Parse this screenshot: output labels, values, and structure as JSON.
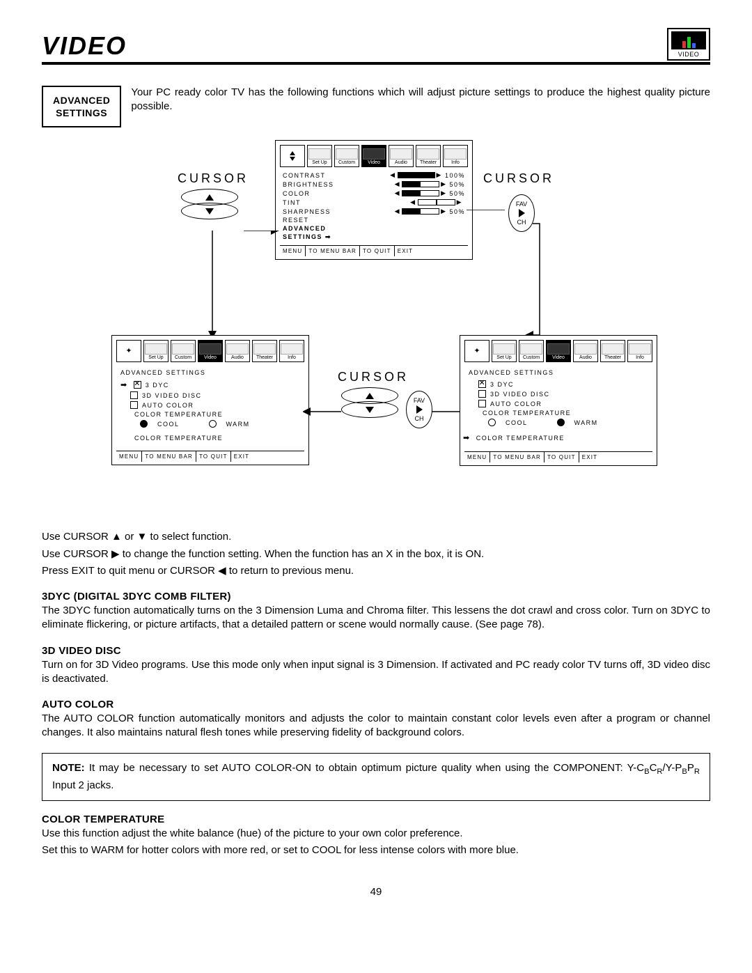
{
  "header": {
    "title": "VIDEO",
    "logo_label": "VIDEO"
  },
  "intro": {
    "box_line1": "ADVANCED",
    "box_line2": "SETTINGS",
    "text": "Your PC ready color TV has the following functions which will adjust picture settings to produce the highest quality picture possible."
  },
  "labels": {
    "cursor": "CURSOR",
    "fav": "FAV",
    "ch": "CH"
  },
  "osd_tabs": [
    "Set Up",
    "Custom",
    "Video",
    "Audio",
    "Theater",
    "Info"
  ],
  "osd_footer": {
    "menu": "MENU",
    "bar": "TO MENU BAR",
    "quit": "TO QUIT",
    "exit": "EXIT"
  },
  "video_menu": {
    "rows": [
      {
        "label": "CONTRAST",
        "value": "100%",
        "fill": 100
      },
      {
        "label": "BRIGHTNESS",
        "value": "50%",
        "fill": 50
      },
      {
        "label": "COLOR",
        "value": "50%",
        "fill": 50
      },
      {
        "label": "TINT",
        "value": "",
        "fill": 50,
        "center": true
      },
      {
        "label": "SHARPNESS",
        "value": "50%",
        "fill": 50
      },
      {
        "label": "RESET",
        "value": "",
        "plain": true
      }
    ],
    "advanced": "ADVANCED",
    "settings": "SETTINGS"
  },
  "adv_menu": {
    "header": "ADVANCED SETTINGS",
    "items": [
      {
        "label": "3 DYC",
        "checked": true
      },
      {
        "label": "3D VIDEO DISC",
        "checked": false
      },
      {
        "label": "AUTO COLOR",
        "checked": false
      }
    ],
    "colortemp_label": "COLOR TEMPERATURE",
    "cool": "COOL",
    "warm": "WARM",
    "bottom": "COLOR TEMPERATURE"
  },
  "instructions": {
    "l1": "Use CURSOR ▲ or ▼ to select function.",
    "l2": "Use CURSOR ▶ to change the function setting. When the function has an  X  in the box, it is ON.",
    "l3": "Press EXIT to quit menu or CURSOR ◀ to return to previous menu."
  },
  "sections": {
    "s1h": "3DYC (DIGITAL 3DYC COMB FILTER)",
    "s1": "The 3DYC function automatically turns on the 3 Dimension Luma and Chroma filter. This lessens the dot crawl and cross color. Turn on 3DYC to eliminate flickering, or picture artifacts, that a detailed pattern or scene would normally cause. (See page 78).",
    "s2h": "3D VIDEO DISC",
    "s2": "Turn on for 3D Video programs. Use this mode only when input signal is 3 Dimension. If activated and PC ready color TV turns off, 3D video disc is deactivated.",
    "s3h": "AUTO COLOR",
    "s3": "The AUTO COLOR function automatically monitors and adjusts the color to maintain constant color levels even after a program or channel changes. It also maintains natural flesh tones while preserving fidelity of background colors.",
    "note": "It may be necessary to set AUTO COLOR-ON to obtain optimum picture quality when using the COMPONENT: Y-C",
    "note_tail": " Input 2 jacks.",
    "note_label": "NOTE:",
    "s4h": "COLOR TEMPERATURE",
    "s4a": "Use this function adjust the white balance (hue) of the picture to your own color preference.",
    "s4b": "Set this to WARM for hotter colors with more red, or set to COOL for less intense colors with more blue."
  },
  "page": "49"
}
